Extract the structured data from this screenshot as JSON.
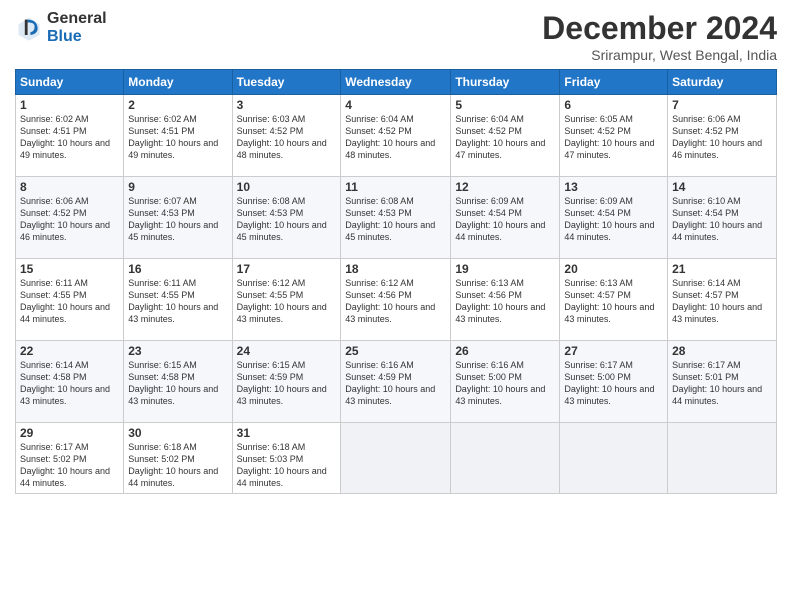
{
  "header": {
    "logo_general": "General",
    "logo_blue": "Blue",
    "month_title": "December 2024",
    "location": "Srirampur, West Bengal, India"
  },
  "calendar": {
    "days_of_week": [
      "Sunday",
      "Monday",
      "Tuesday",
      "Wednesday",
      "Thursday",
      "Friday",
      "Saturday"
    ],
    "weeks": [
      [
        null,
        {
          "day": "2",
          "sunrise": "6:02 AM",
          "sunset": "4:51 PM",
          "daylight": "10 hours and 49 minutes."
        },
        {
          "day": "3",
          "sunrise": "6:03 AM",
          "sunset": "4:52 PM",
          "daylight": "10 hours and 48 minutes."
        },
        {
          "day": "4",
          "sunrise": "6:04 AM",
          "sunset": "4:52 PM",
          "daylight": "10 hours and 48 minutes."
        },
        {
          "day": "5",
          "sunrise": "6:04 AM",
          "sunset": "4:52 PM",
          "daylight": "10 hours and 47 minutes."
        },
        {
          "day": "6",
          "sunrise": "6:05 AM",
          "sunset": "4:52 PM",
          "daylight": "10 hours and 47 minutes."
        },
        {
          "day": "7",
          "sunrise": "6:06 AM",
          "sunset": "4:52 PM",
          "daylight": "10 hours and 46 minutes."
        }
      ],
      [
        {
          "day": "1",
          "sunrise": "6:02 AM",
          "sunset": "4:51 PM",
          "daylight": "10 hours and 49 minutes."
        },
        null,
        null,
        null,
        null,
        null,
        null
      ],
      [
        {
          "day": "8",
          "sunrise": "6:06 AM",
          "sunset": "4:52 PM",
          "daylight": "10 hours and 46 minutes."
        },
        {
          "day": "9",
          "sunrise": "6:07 AM",
          "sunset": "4:53 PM",
          "daylight": "10 hours and 45 minutes."
        },
        {
          "day": "10",
          "sunrise": "6:08 AM",
          "sunset": "4:53 PM",
          "daylight": "10 hours and 45 minutes."
        },
        {
          "day": "11",
          "sunrise": "6:08 AM",
          "sunset": "4:53 PM",
          "daylight": "10 hours and 45 minutes."
        },
        {
          "day": "12",
          "sunrise": "6:09 AM",
          "sunset": "4:54 PM",
          "daylight": "10 hours and 44 minutes."
        },
        {
          "day": "13",
          "sunrise": "6:09 AM",
          "sunset": "4:54 PM",
          "daylight": "10 hours and 44 minutes."
        },
        {
          "day": "14",
          "sunrise": "6:10 AM",
          "sunset": "4:54 PM",
          "daylight": "10 hours and 44 minutes."
        }
      ],
      [
        {
          "day": "15",
          "sunrise": "6:11 AM",
          "sunset": "4:55 PM",
          "daylight": "10 hours and 44 minutes."
        },
        {
          "day": "16",
          "sunrise": "6:11 AM",
          "sunset": "4:55 PM",
          "daylight": "10 hours and 43 minutes."
        },
        {
          "day": "17",
          "sunrise": "6:12 AM",
          "sunset": "4:55 PM",
          "daylight": "10 hours and 43 minutes."
        },
        {
          "day": "18",
          "sunrise": "6:12 AM",
          "sunset": "4:56 PM",
          "daylight": "10 hours and 43 minutes."
        },
        {
          "day": "19",
          "sunrise": "6:13 AM",
          "sunset": "4:56 PM",
          "daylight": "10 hours and 43 minutes."
        },
        {
          "day": "20",
          "sunrise": "6:13 AM",
          "sunset": "4:57 PM",
          "daylight": "10 hours and 43 minutes."
        },
        {
          "day": "21",
          "sunrise": "6:14 AM",
          "sunset": "4:57 PM",
          "daylight": "10 hours and 43 minutes."
        }
      ],
      [
        {
          "day": "22",
          "sunrise": "6:14 AM",
          "sunset": "4:58 PM",
          "daylight": "10 hours and 43 minutes."
        },
        {
          "day": "23",
          "sunrise": "6:15 AM",
          "sunset": "4:58 PM",
          "daylight": "10 hours and 43 minutes."
        },
        {
          "day": "24",
          "sunrise": "6:15 AM",
          "sunset": "4:59 PM",
          "daylight": "10 hours and 43 minutes."
        },
        {
          "day": "25",
          "sunrise": "6:16 AM",
          "sunset": "4:59 PM",
          "daylight": "10 hours and 43 minutes."
        },
        {
          "day": "26",
          "sunrise": "6:16 AM",
          "sunset": "5:00 PM",
          "daylight": "10 hours and 43 minutes."
        },
        {
          "day": "27",
          "sunrise": "6:17 AM",
          "sunset": "5:00 PM",
          "daylight": "10 hours and 43 minutes."
        },
        {
          "day": "28",
          "sunrise": "6:17 AM",
          "sunset": "5:01 PM",
          "daylight": "10 hours and 44 minutes."
        }
      ],
      [
        {
          "day": "29",
          "sunrise": "6:17 AM",
          "sunset": "5:02 PM",
          "daylight": "10 hours and 44 minutes."
        },
        {
          "day": "30",
          "sunrise": "6:18 AM",
          "sunset": "5:02 PM",
          "daylight": "10 hours and 44 minutes."
        },
        {
          "day": "31",
          "sunrise": "6:18 AM",
          "sunset": "5:03 PM",
          "daylight": "10 hours and 44 minutes."
        },
        null,
        null,
        null,
        null
      ]
    ]
  }
}
